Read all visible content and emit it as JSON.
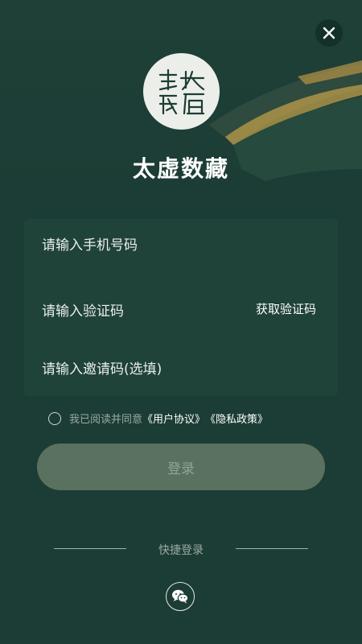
{
  "header": {
    "app_title": "太虚数藏",
    "logo_text": "太虚数藏",
    "close_icon": "close-icon"
  },
  "form": {
    "phone_placeholder": "请输入手机号码",
    "code_placeholder": "请输入验证码",
    "get_code_label": "获取验证码",
    "invite_placeholder": "请输入邀请码(选填)"
  },
  "agreement": {
    "prefix": "我已阅读并同意",
    "user_agreement": "《用户协议》",
    "privacy_policy": "《隐私政策》",
    "checked": false
  },
  "login_button": "登录",
  "quick_login": {
    "label": "快捷登录",
    "wechat_icon": "wechat-icon"
  },
  "colors": {
    "background": "#1c3d35",
    "login_button": "#5a715f"
  }
}
